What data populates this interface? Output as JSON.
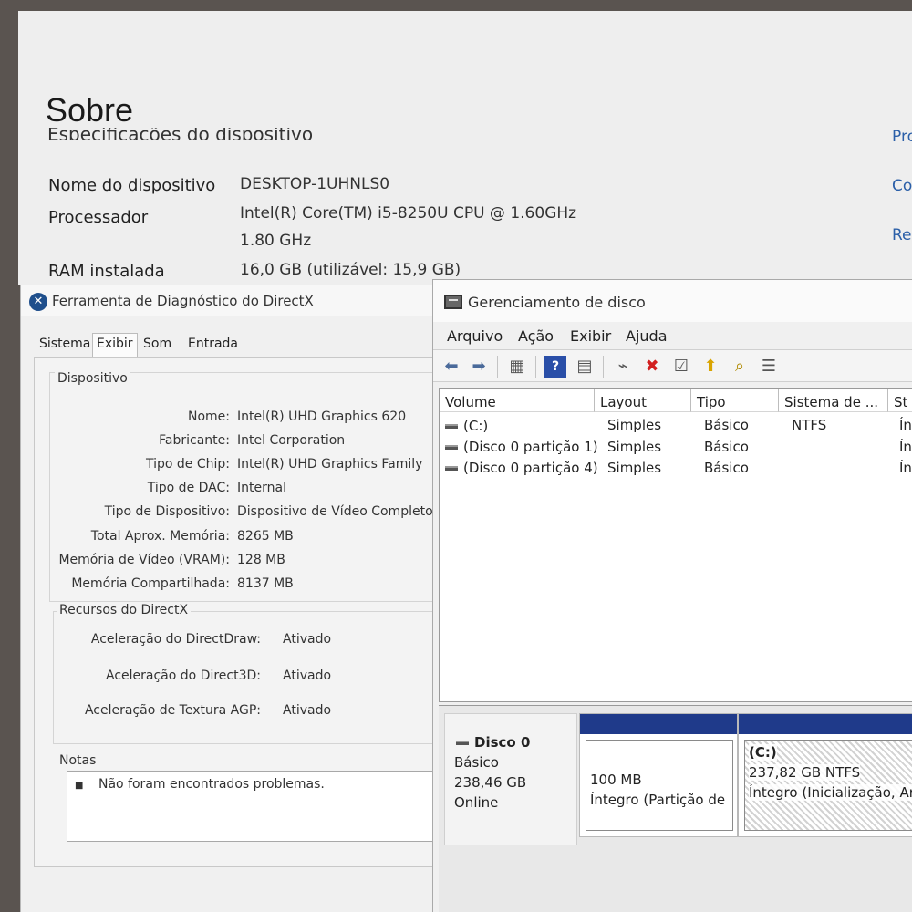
{
  "settings": {
    "title": "Sobre",
    "subtitle": "Especificações do dispositivo",
    "rows": [
      {
        "label": "Nome do dispositivo",
        "value": "DESKTOP-1UHNLS0"
      },
      {
        "label": "Processador",
        "value": "Intel(R) Core(TM) i5-8250U CPU @ 1.60GHz",
        "value2": "1.80 GHz"
      },
      {
        "label": "RAM instalada",
        "value": "16,0 GB (utilizável: 15,9 GB)"
      }
    ],
    "right_links": [
      "Pro",
      "Co",
      "Re"
    ]
  },
  "directx": {
    "title": "Ferramenta de Diagnóstico do DirectX",
    "tabs": [
      "Sistema",
      "Exibir",
      "Som",
      "Entrada"
    ],
    "active_tab": "Exibir",
    "device_group": "Dispositivo",
    "device_rows": [
      {
        "k": "Nome:",
        "v": "Intel(R) UHD Graphics 620"
      },
      {
        "k": "Fabricante:",
        "v": "Intel Corporation"
      },
      {
        "k": "Tipo de Chip:",
        "v": "Intel(R) UHD Graphics Family"
      },
      {
        "k": "Tipo de DAC:",
        "v": "Internal"
      },
      {
        "k": "Tipo de Dispositivo:",
        "v": "Dispositivo de Vídeo Completo"
      },
      {
        "k": "Total Aprox. Memória:",
        "v": "8265 MB"
      },
      {
        "k": "Memória de Vídeo (VRAM):",
        "v": "128 MB"
      },
      {
        "k": "Memória Compartilhada:",
        "v": "8137 MB"
      }
    ],
    "resources_group": "Recursos do DirectX",
    "resource_rows": [
      {
        "k": "Aceleração do DirectDraw:",
        "v": "Ativado"
      },
      {
        "k": "Aceleração do Direct3D:",
        "v": "Ativado"
      },
      {
        "k": "Aceleração de Textura AGP:",
        "v": "Ativado"
      }
    ],
    "notes_label": "Notas",
    "notes_text": "Não foram encontrados problemas."
  },
  "diskmgmt": {
    "title": "Gerenciamento de disco",
    "menu": [
      "Arquivo",
      "Ação",
      "Exibir",
      "Ajuda"
    ],
    "columns": [
      "Volume",
      "Layout",
      "Tipo",
      "Sistema de ...",
      "St"
    ],
    "volumes": [
      {
        "volume": "(C:)",
        "layout": "Simples",
        "tipo": "Básico",
        "fs": "NTFS",
        "status": "Ín"
      },
      {
        "volume": "(Disco 0 partição 1)",
        "layout": "Simples",
        "tipo": "Básico",
        "fs": "",
        "status": "Ín"
      },
      {
        "volume": "(Disco 0 partição 4)",
        "layout": "Simples",
        "tipo": "Básico",
        "fs": "",
        "status": "Ín"
      }
    ],
    "disk": {
      "name": "Disco 0",
      "type": "Básico",
      "size": "238,46 GB",
      "state": "Online"
    },
    "partitions": [
      {
        "label": "",
        "size": "100 MB",
        "status": "Íntegro (Partição de"
      },
      {
        "label": "(C:)",
        "size": "237,82 GB NTFS",
        "status": "Íntegro (Inicialização, Arq"
      }
    ],
    "colors": {
      "partition_bar": "#1f3a8a"
    }
  }
}
